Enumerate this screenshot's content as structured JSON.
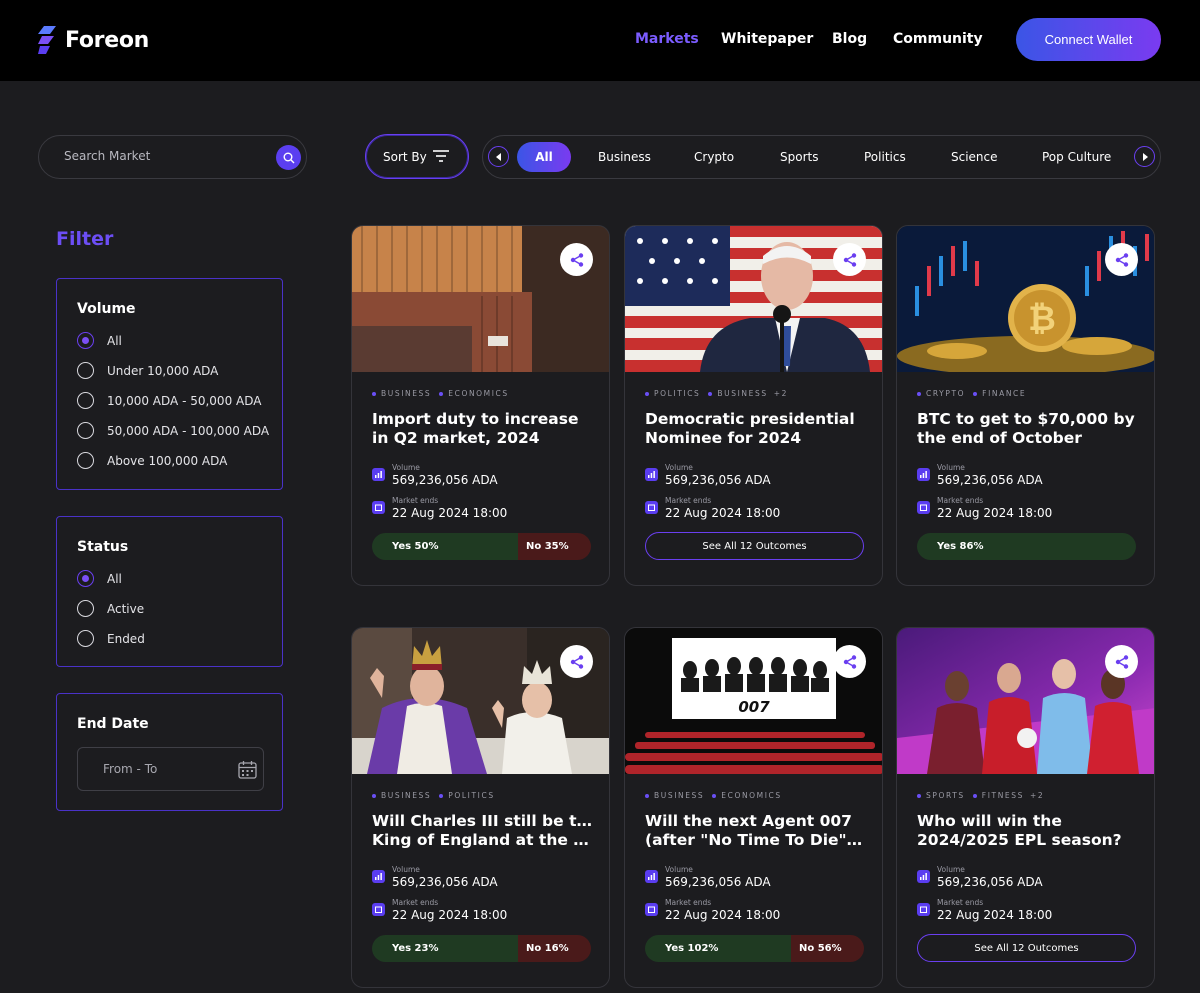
{
  "brand": {
    "name": "Foreon",
    "accent": "#6c4ef5"
  },
  "nav": {
    "items": [
      "Markets",
      "Whitepaper",
      "Blog",
      "Community"
    ],
    "active": "Markets",
    "connect": "Connect Wallet"
  },
  "search": {
    "placeholder": "Search Market"
  },
  "sort": {
    "label": "Sort By"
  },
  "categories": [
    "All",
    "Business",
    "Crypto",
    "Sports",
    "Politics",
    "Science",
    "Pop Culture"
  ],
  "filter": {
    "title": "Filter",
    "volume": {
      "title": "Volume",
      "options": [
        "All",
        "Under 10,000 ADA",
        "10,000 ADA - 50,000 ADA",
        "50,000 ADA - 100,000 ADA",
        "Above 100,000 ADA"
      ],
      "selected": "All"
    },
    "status": {
      "title": "Status",
      "options": [
        "All",
        "Active",
        "Ended"
      ],
      "selected": "All"
    },
    "end_date": {
      "title": "End Date",
      "placeholder": "From - To"
    }
  },
  "cards": [
    {
      "tags": [
        "BUSINESS",
        "ECONOMICS"
      ],
      "tag_more": "",
      "title": "Import duty to increase in Q2 market, 2024",
      "volume_label": "Volume",
      "volume": "569,236,056 ADA",
      "ends_label": "Market ends",
      "ends": "22 Aug 2024 18:00",
      "yes": "Yes 50%",
      "yes_value": 50,
      "no": "No 35%",
      "no_value": 35
    },
    {
      "tags": [
        "POLITICS",
        "BUSINESS"
      ],
      "tag_more": "+2",
      "title": "Democratic presidential Nominee for 2024",
      "volume_label": "Volume",
      "volume": "569,236,056 ADA",
      "ends_label": "Market ends",
      "ends": "22 Aug 2024 18:00",
      "outcomes": "See All 12 Outcomes"
    },
    {
      "tags": [
        "CRYPTO",
        "FINANCE"
      ],
      "tag_more": "",
      "title": "BTC to get to $70,000 by the end of October",
      "volume_label": "Volume",
      "volume": "569,236,056 ADA",
      "ends_label": "Market ends",
      "ends": "22 Aug 2024 18:00",
      "yes": "Yes 86%",
      "yes_value": 86
    },
    {
      "tags": [
        "BUSINESS",
        "POLITICS"
      ],
      "tag_more": "",
      "title_line1": "Will Charles III still be the",
      "title_line2": "King of England at the end o...",
      "volume_label": "Volume",
      "volume": "569,236,056 ADA",
      "ends_label": "Market ends",
      "ends": "22 Aug 2024 18:00",
      "yes": "Yes 23%",
      "yes_value": 23,
      "no": "No 16%",
      "no_value": 16
    },
    {
      "tags": [
        "BUSINESS",
        "ECONOMICS"
      ],
      "tag_more": "",
      "title_line1": "Will the next Agent 007",
      "title_line2": "(after \"No Time To Die\") be b...",
      "volume_label": "Volume",
      "volume": "569,236,056 ADA",
      "ends_label": "Market ends",
      "ends": "22 Aug 2024 18:00",
      "yes": "Yes 102%",
      "yes_value": 102,
      "no": "No 56%",
      "no_value": 56
    },
    {
      "tags": [
        "SPORTS",
        "FITNESS"
      ],
      "tag_more": "+2",
      "title": "Who will win the 2024/2025 EPL season?",
      "volume_label": "Volume",
      "volume": "569,236,056 ADA",
      "ends_label": "Market ends",
      "ends": "22 Aug 2024 18:00",
      "outcomes": "See All 12 Outcomes"
    }
  ]
}
